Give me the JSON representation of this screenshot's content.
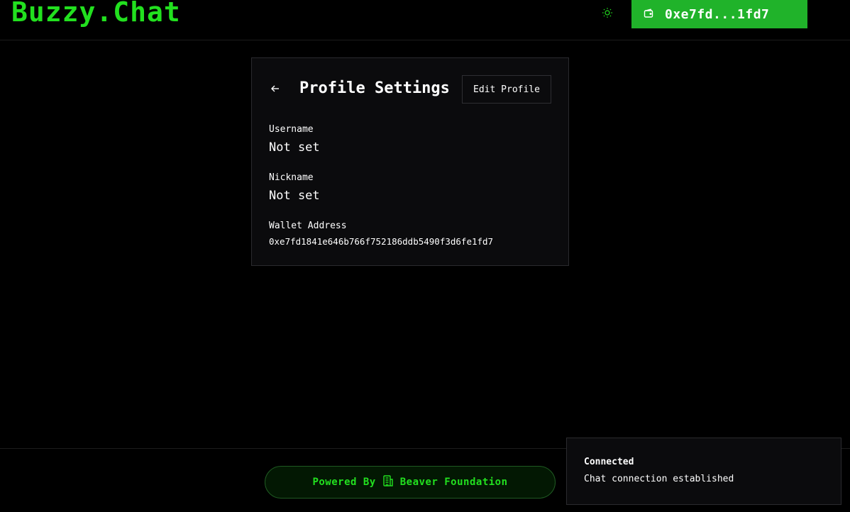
{
  "header": {
    "logo": "Buzzy.Chat",
    "wallet_button_label": "0xe7fd...1fd7",
    "theme_icon": "sun-icon",
    "wallet_icon": "wallet-icon"
  },
  "profile": {
    "title": "Profile Settings",
    "edit_label": "Edit Profile",
    "back_icon": "arrow-left-icon",
    "fields": [
      {
        "label": "Username",
        "value": "Not set"
      },
      {
        "label": "Nickname",
        "value": "Not set"
      },
      {
        "label": "Wallet Address",
        "value": "0xe7fd1841e646b766f752186ddb5490f3d6fe1fd7"
      }
    ]
  },
  "footer": {
    "powered_by": "Powered By",
    "foundation": "Beaver Foundation",
    "foundation_icon": "building-icon"
  },
  "toast": {
    "title": "Connected",
    "description": "Chat connection established"
  },
  "colors": {
    "brand_green": "#22e01f",
    "button_green": "#20b32a",
    "background": "#000000",
    "card": "#0b0b0d"
  }
}
